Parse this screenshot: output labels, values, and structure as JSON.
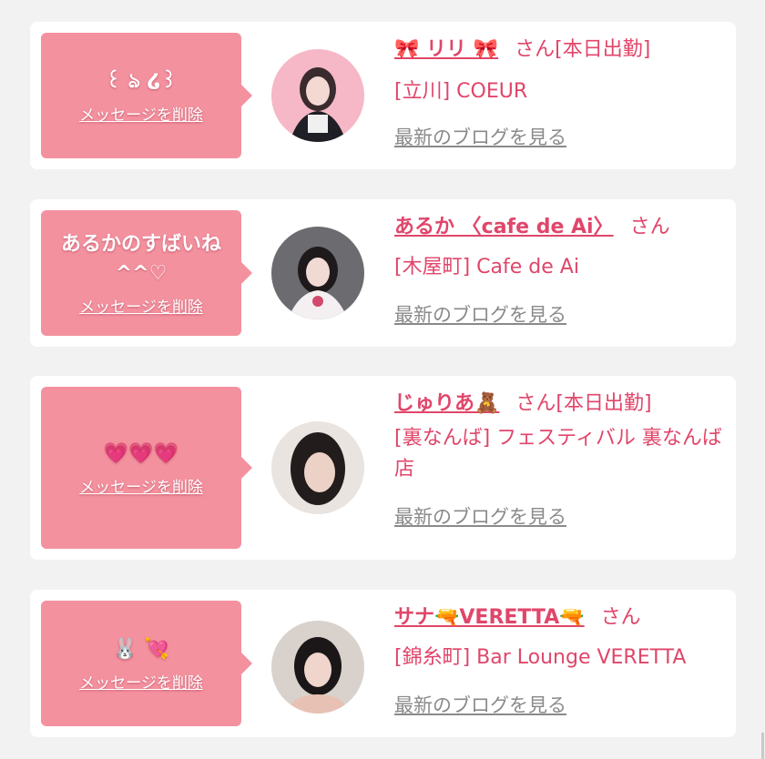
{
  "delete_label": "メッセージを削除",
  "blog_label": "最新のブログを見る",
  "cards": [
    {
      "message": "꒰ ঌ ໒꒱",
      "name": "🎀 リリ 🎀",
      "suffix": "さん[本日出勤]",
      "shop": "[立川] COEUR"
    },
    {
      "message": "あるかのすばいね^^♡",
      "name": "あるか 〈cafe de Ai〉",
      "suffix": "さん",
      "shop": "[木屋町] Cafe de Ai"
    },
    {
      "message": "💗💗💗",
      "name": "じゅりあ🧸",
      "suffix": "さん[本日出勤]",
      "shop": "[裏なんば] フェスティバル 裏なんば店"
    },
    {
      "message": "🐰 💘",
      "name": "サナ🔫VERETTA🔫",
      "suffix": "さん",
      "shop": "[錦糸町] Bar Lounge VERETTA"
    }
  ]
}
